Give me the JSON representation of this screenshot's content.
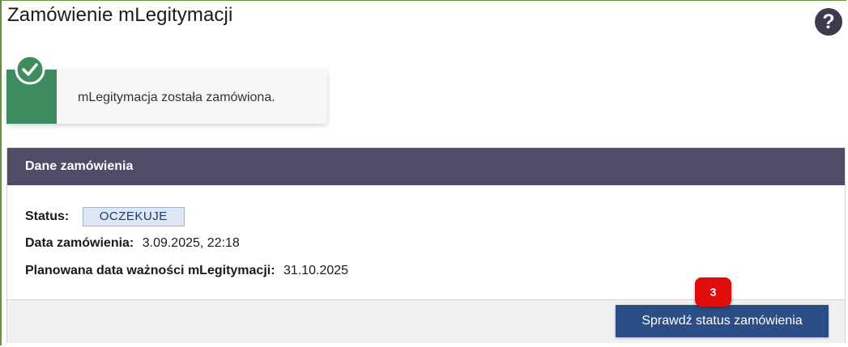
{
  "page": {
    "title": "Zamówienie mLegitymacji",
    "help_icon_glyph": "?"
  },
  "alert": {
    "message": "mLegitymacja została zamówiona.",
    "icon": "check-circle-icon",
    "color": "#3e8c5f"
  },
  "order_panel": {
    "header": "Dane zamówienia",
    "status_label": "Status:",
    "status_value": "OCZEKUJE",
    "order_date_label": "Data zamówienia:",
    "order_date_value": "3.09.2025, 22:18",
    "expiry_label": "Planowana data ważności mLegitymacji:",
    "expiry_value": "31.10.2025",
    "check_status_button": "Sprawdź status zamówienia"
  },
  "annotation": {
    "step_number": "3",
    "color": "#e10d0d"
  },
  "colors": {
    "header_bg": "#4f4c68",
    "button_bg": "#2b4e87"
  }
}
